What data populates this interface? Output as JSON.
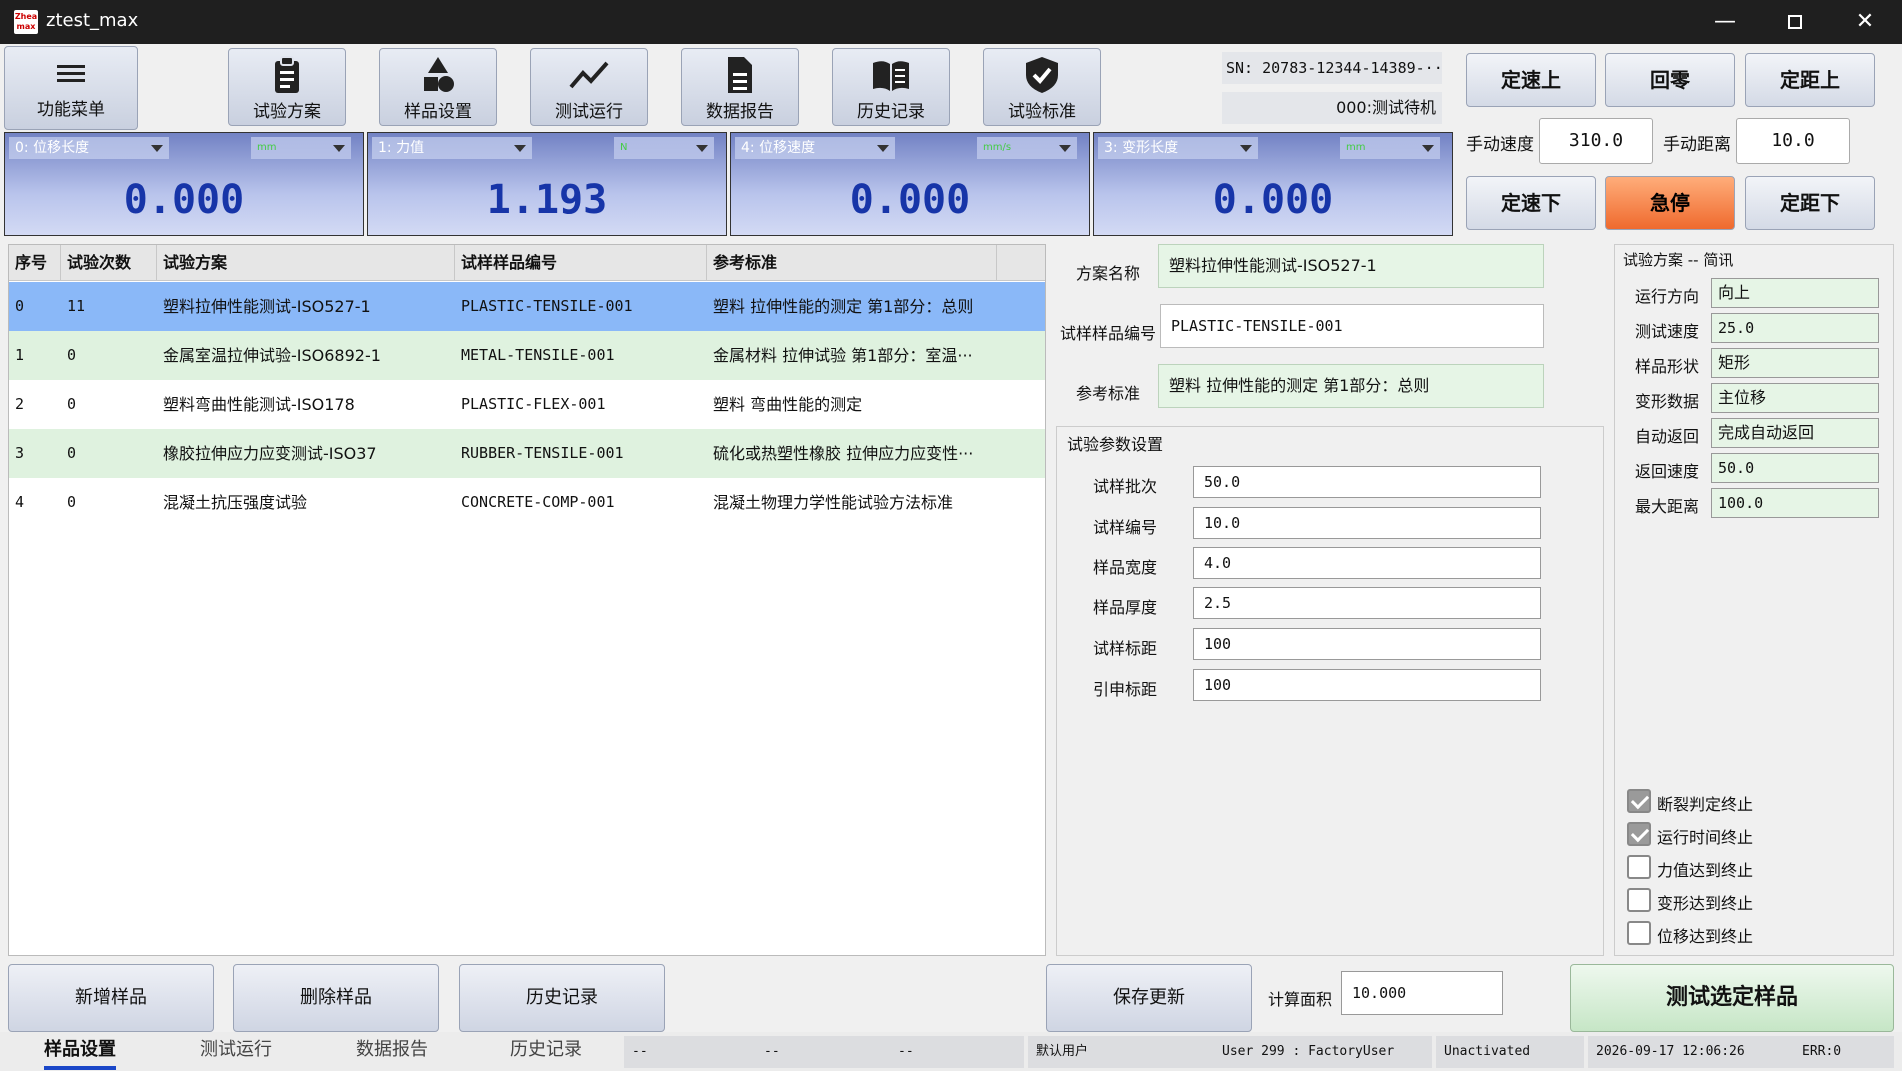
{
  "window": {
    "title": "ztest_max",
    "logo_text": "Zhea max"
  },
  "toolbar": {
    "menu_label": "功能菜单",
    "buttons": [
      {
        "label": "试验方案",
        "icon": "clipboard-icon"
      },
      {
        "label": "样品设置",
        "icon": "shapes-icon"
      },
      {
        "label": "测试运行",
        "icon": "chart-line-icon"
      },
      {
        "label": "数据报告",
        "icon": "document-icon"
      },
      {
        "label": "历史记录",
        "icon": "book-icon"
      },
      {
        "label": "试验标准",
        "icon": "shield-check-icon"
      }
    ]
  },
  "device": {
    "sn": "SN: 20783-12344-14389-···",
    "status": "000:测试待机"
  },
  "motion": {
    "up_speed": "定速上",
    "zero": "回零",
    "up_dist": "定距上",
    "manual_speed_label": "手动速度",
    "manual_speed": "310.0",
    "manual_dist_label": "手动距离",
    "manual_dist": "10.0",
    "down_speed": "定速下",
    "estop": "急停",
    "down_dist": "定距下"
  },
  "readouts": [
    {
      "channel": "0: 位移长度",
      "unit": "mm",
      "value": "0.000"
    },
    {
      "channel": "1: 力值",
      "unit": "N",
      "value": "1.193"
    },
    {
      "channel": "4: 位移速度",
      "unit": "mm/s",
      "value": "0.000"
    },
    {
      "channel": "3: 变形长度",
      "unit": "mm",
      "value": "0.000"
    }
  ],
  "table": {
    "headers": [
      "序号",
      "试验次数",
      "试验方案",
      "试样样品编号",
      "参考标准"
    ],
    "rows": [
      [
        "0",
        "11",
        "塑料拉伸性能测试-ISO527-1",
        "PLASTIC-TENSILE-001",
        "塑料 拉伸性能的测定 第1部分：总则"
      ],
      [
        "1",
        "0",
        "金属室温拉伸试验-ISO6892-1",
        "METAL-TENSILE-001",
        "金属材料 拉伸试验 第1部分：室温···"
      ],
      [
        "2",
        "0",
        "塑料弯曲性能测试-ISO178",
        "PLASTIC-FLEX-001",
        "塑料 弯曲性能的测定"
      ],
      [
        "3",
        "0",
        "橡胶拉伸应力应变测试-ISO37",
        "RUBBER-TENSILE-001",
        "硫化或热塑性橡胶 拉伸应力应变性···"
      ],
      [
        "4",
        "0",
        "混凝土抗压强度试验",
        "CONCRETE-COMP-001",
        "混凝土物理力学性能试验方法标准"
      ]
    ]
  },
  "form": {
    "plan_name_label": "方案名称",
    "plan_name": "塑料拉伸性能测试-ISO527-1",
    "sample_id_label": "试样样品编号",
    "sample_id": "PLASTIC-TENSILE-001",
    "standard_label": "参考标准",
    "standard": "塑料 拉伸性能的测定 第1部分：总则"
  },
  "params": {
    "title": "试验参数设置",
    "items": [
      {
        "label": "试样批次",
        "value": "50.0"
      },
      {
        "label": "试样编号",
        "value": "10.0"
      },
      {
        "label": "样品宽度",
        "value": "4.0"
      },
      {
        "label": "样品厚度",
        "value": "2.5"
      },
      {
        "label": "试样标距",
        "value": "100"
      },
      {
        "label": "引申标距",
        "value": "100"
      }
    ]
  },
  "summary": {
    "title": "试验方案 -- 简讯",
    "items": [
      {
        "label": "运行方向",
        "value": "向上"
      },
      {
        "label": "测试速度",
        "value": "25.0"
      },
      {
        "label": "样品形状",
        "value": "矩形"
      },
      {
        "label": "变形数据",
        "value": "主位移"
      },
      {
        "label": "自动返回",
        "value": "完成自动返回"
      },
      {
        "label": "返回速度",
        "value": "50.0"
      },
      {
        "label": "最大距离",
        "value": "100.0"
      }
    ],
    "checks": [
      {
        "label": "断裂判定终止",
        "checked": true
      },
      {
        "label": "运行时间终止",
        "checked": true
      },
      {
        "label": "力值达到终止",
        "checked": false
      },
      {
        "label": "变形达到终止",
        "checked": false
      },
      {
        "label": "位移达到终止",
        "checked": false
      }
    ]
  },
  "actions": {
    "add": "新增样品",
    "delete": "删除样品",
    "history": "历史记录",
    "save": "保存更新",
    "area_label": "计算面积",
    "area": "10.000",
    "test": "测试选定样品"
  },
  "statusbar": {
    "tabs": [
      "样品设置",
      "测试运行",
      "数据报告",
      "历史记录"
    ],
    "f1": "--",
    "f2": "--",
    "f3": "--",
    "user_default": "默认用户",
    "user": "User 299 : FactoryUser",
    "activation": "Unactivated",
    "datetime": "2026-09-17 12:06:26",
    "err": "ERR:0"
  },
  "colors": {
    "selected_row": "#8ab8f8",
    "alt_row": "#dff2df",
    "estop": "#f07a3c",
    "readout_value": "#1735a8"
  }
}
